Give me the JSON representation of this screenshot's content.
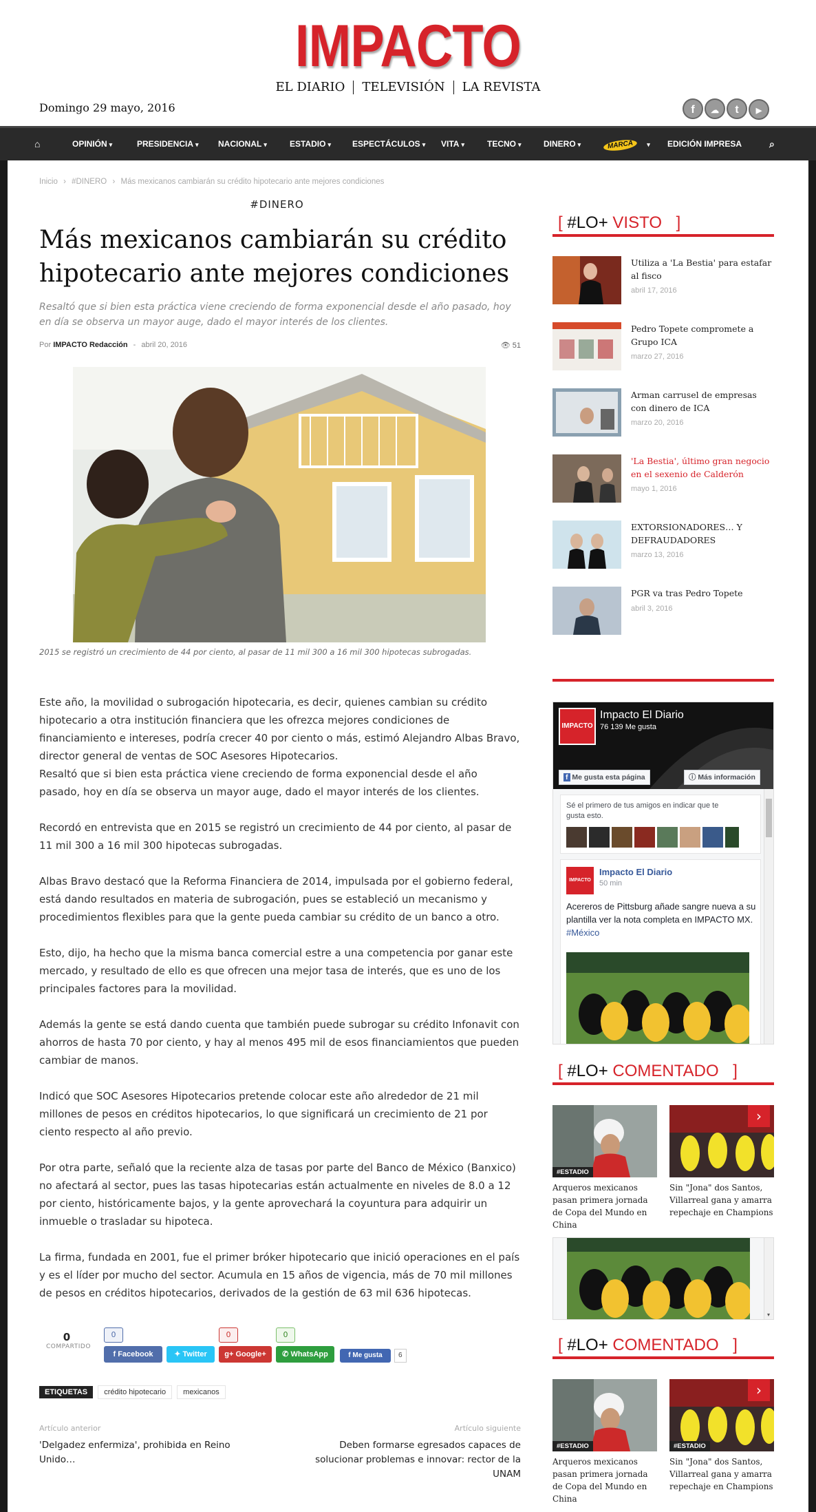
{
  "site": {
    "logo": "IMPACTO",
    "submenu": [
      "EL DIARIO",
      "TELEVISIÓN",
      "LA REVISTA"
    ],
    "date": "Domingo 29 mayo, 2016",
    "social_icons": [
      "facebook-icon",
      "soundcloud-icon",
      "twitter-icon",
      "youtube-icon"
    ]
  },
  "nav": {
    "home_icon": "home-icon",
    "items": [
      "OPINIÓN",
      "PRESIDENCIA",
      "NACIONAL",
      "ESTADIO",
      "ESPECTÁCULOS",
      "VITA",
      "TECNO",
      "DINERO"
    ],
    "marca_label": "MARCA",
    "print_label": "EDICIÓN IMPRESA",
    "search_icon": "search-icon"
  },
  "breadcrumb": {
    "home": "Inicio",
    "sep": "›",
    "category": "#DINERO",
    "current": "Más mexicanos cambiarán su crédito hipotecario ante mejores condiciones"
  },
  "article": {
    "category": "#DINERO",
    "title": "Más mexicanos cambiarán su crédito hipotecario ante mejores condiciones",
    "subtitle": "Resaltó que si bien esta práctica viene creciendo de forma exponencial desde el año pasado, hoy en día se observa un mayor auge, dado el mayor interés de los clientes.",
    "by_label": "Por",
    "author": "IMPACTO Redacción",
    "dash": "-",
    "date": "abril 20, 2016",
    "views": "51",
    "caption": "2015 se registró un crecimiento de 44 por ciento, al pasar de 11 mil 300 a 16 mil 300 hipotecas subrogadas.",
    "paragraphs": [
      "Este año, la movilidad o subrogación hipotecaria, es decir, quienes cambian su crédito hipotecario a otra institución financiera que les ofrezca mejores condiciones de financiamiento e intereses, podría crecer 40 por ciento o más, estimó Alejandro Albas Bravo, director general de ventas de SOC Asesores Hipotecarios.\nResaltó que si bien esta práctica viene creciendo de forma exponencial desde el año pasado, hoy en día se observa un mayor auge, dado el mayor interés de los clientes.",
      "Recordó en entrevista que en 2015 se registró un crecimiento de 44 por ciento, al pasar de 11 mil 300 a 16 mil 300 hipotecas subrogadas.",
      "Albas Bravo destacó que la Reforma Financiera de 2014, impulsada por el gobierno federal, está dando resultados en materia de subrogación, pues se estableció un mecanismo y procedimientos flexibles para que la gente pueda cambiar su crédito de un banco a otro.",
      "Esto, dijo, ha hecho que la misma banca comercial estre a una competencia por ganar este mercado, y resultado de ello es que ofrecen una mejor tasa de interés, que es uno de los principales factores para la movilidad.",
      "Además la gente se está dando cuenta que también puede subrogar su crédito Infonavit con ahorros de hasta 70 por ciento, y hay al menos 495 mil de esos financiamientos que pueden cambiar de manos.",
      "Indicó que SOC Asesores Hipotecarios pretende colocar este año alrededor de 21 mil millones de pesos en créditos hipotecarios, lo que significará un crecimiento de 21 por ciento respecto al año previo.",
      "Por otra parte, señaló que la reciente alza de tasas por parte del Banco de México (Banxico) no afectará al sector, pues las tasas hipotecarias están actualmente en niveles de 8.0 a 12 por ciento, históricamente bajos, y la gente aprovechará la coyuntura para adquirir un inmueble o trasladar su hipoteca.",
      "La firma, fundada en 2001, fue el primer bróker hipotecario que inició operaciones en el país y es el líder por mucho del sector. Acumula en 15 años de vigencia, más de 70 mil millones de pesos en créditos hipotecarios, derivados de la gestión de 63 mil 636 hipotecas."
    ]
  },
  "share": {
    "count": "0",
    "count_label": "COMPARTIDO",
    "facebook": {
      "label": "Facebook",
      "count": "0",
      "color": "#516eab"
    },
    "twitter": {
      "label": "Twitter",
      "color": "#29c5f6"
    },
    "google": {
      "label": "Google+",
      "count": "0",
      "color": "#cc3733"
    },
    "whatsapp": {
      "label": "WhatsApp",
      "count": "0",
      "color": "#7bbf6a"
    },
    "like": {
      "label": "Me gusta",
      "count": "6"
    }
  },
  "tags": {
    "label": "ETIQUETAS",
    "items": [
      "crédito hipotecario",
      "mexicanos"
    ]
  },
  "prevnext": {
    "prev_label": "Artículo anterior",
    "prev_title": "'Delgadez enfermiza', prohibida en Reino Unido…",
    "next_label": "Artículo siguiente",
    "next_title": "Deben formarse egresados capaces de solucionar problemas e innovar: rector de la UNAM"
  },
  "sidebar": {
    "visto": {
      "open": "[",
      "prefix": "#LO+",
      "highlight": "VISTO",
      "close": "]",
      "items": [
        {
          "title": "Utiliza a 'La Bestia' para estafar al fisco",
          "date": "abril 17, 2016"
        },
        {
          "title": "Pedro Topete compromete a Grupo ICA",
          "date": "marzo 27, 2016"
        },
        {
          "title": "Arman carrusel de empresas con dinero de ICA",
          "date": "marzo 20, 2016"
        },
        {
          "title": "'La Bestia', último gran negocio en el sexenio de Calderón",
          "date": "mayo 1, 2016"
        },
        {
          "title": "EXTORSIONADORES… Y DEFRAUDADORES",
          "date": "marzo 13, 2016"
        },
        {
          "title": "PGR va tras Pedro Topete",
          "date": "abril 3, 2016"
        }
      ]
    },
    "facebook": {
      "page_name": "Impacto El Diario",
      "likes": "76 139 Me gusta",
      "like_button": "Me gusta esta página",
      "info_button": "Más información",
      "friends_text": "Sé el primero de tus amigos en indicar que te gusta esto.",
      "post_author": "Impacto El Diario",
      "post_time": "50 min",
      "post_text": "Acereros de Pittsburg añade sangre nueva a su plantilla ver la nota completa en IMPACTO MX.",
      "post_hashtag": "#México",
      "mini_logo": "IMPACTO"
    },
    "comentado": {
      "open": "[",
      "prefix": "#LO+",
      "highlight": "COMENTADO",
      "close": "]",
      "items": [
        {
          "tag": "#ESTADIO",
          "title": "Arqueros mexicanos pasan primera jornada de Copa del Mundo en China"
        },
        {
          "tag": "#ESTADIO",
          "title": "Sin \"Jona\" dos Santos, Villarreal gana y amarra repechaje en Champions"
        }
      ]
    }
  }
}
